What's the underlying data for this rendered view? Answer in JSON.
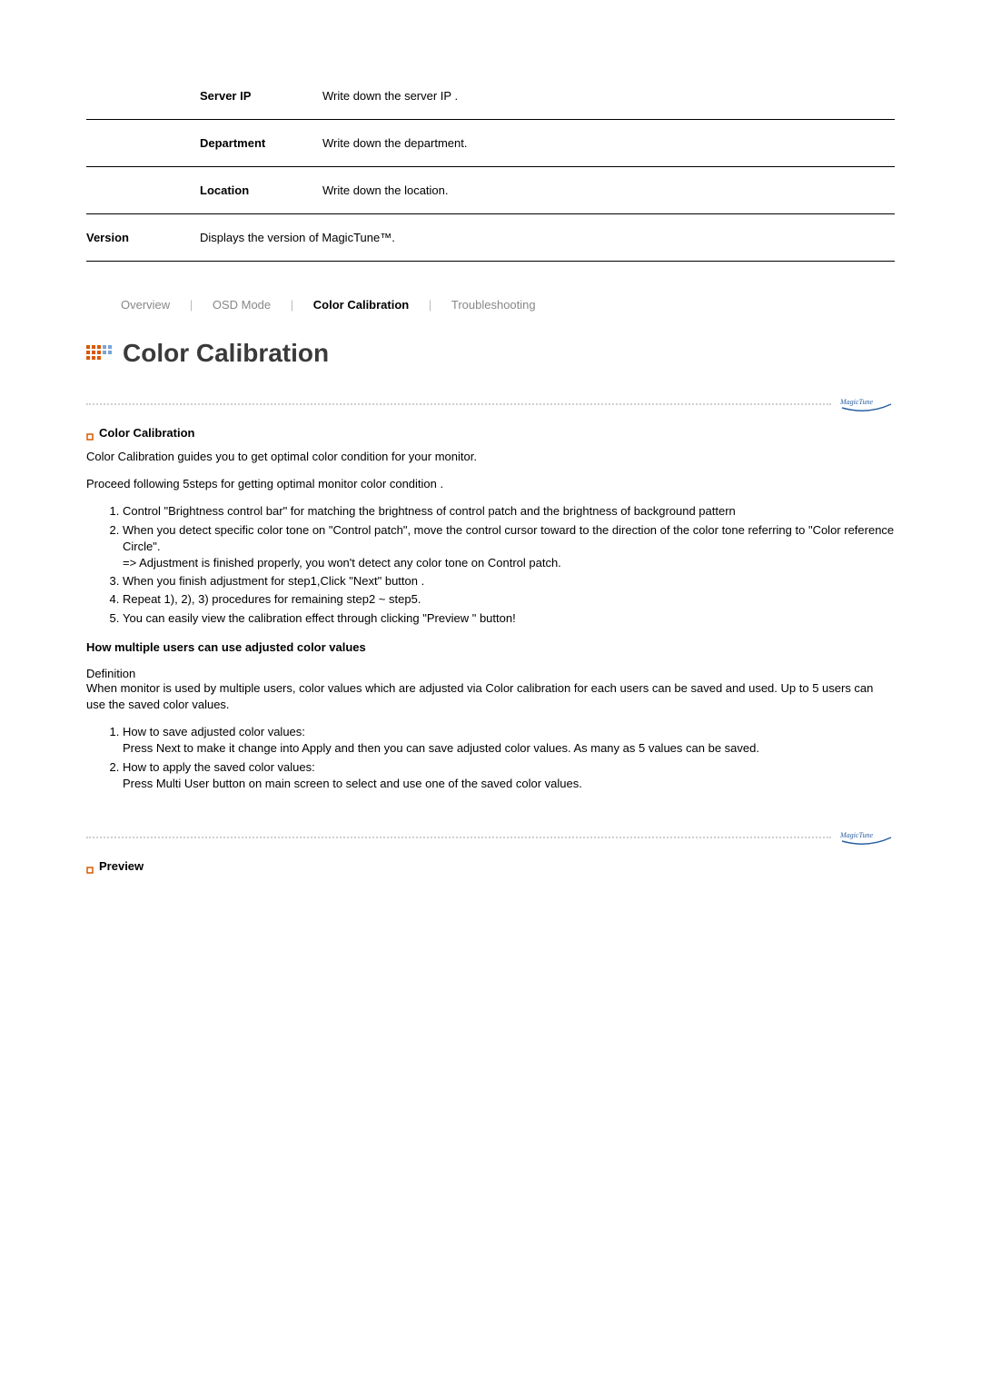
{
  "info_table": {
    "rows": [
      {
        "label": "Server IP",
        "desc": "Write down the server IP ."
      },
      {
        "label": "Department",
        "desc": "Write down the department."
      },
      {
        "label": "Location",
        "desc": "Write down the location."
      }
    ],
    "version_label": "Version",
    "version_desc": "Displays the version of MagicTune™."
  },
  "tabs": {
    "overview": "Overview",
    "osd_mode": "OSD Mode",
    "color_calibration": "Color Calibration",
    "troubleshooting": "Troubleshooting"
  },
  "section_title": "Color Calibration",
  "sub1_title": "Color Calibration",
  "sub1_intro": "Color Calibration guides you to get optimal color condition for your monitor.",
  "sub1_proceed": "Proceed following 5steps for getting optimal monitor color condition .",
  "steps": [
    "Control \"Brightness control bar\" for matching the brightness of control patch and the brightness of background pattern",
    "When you detect specific color tone on \"Control patch\", move the control cursor toward to the direction of the color tone referring to \"Color reference Circle\".\n=> Adjustment is finished properly, you won't detect any color tone on Control patch.",
    "When you finish adjustment for step1,Click \"Next\" button .",
    "Repeat 1), 2), 3) procedures for remaining step2 ~ step5.",
    "You can easily view the calibration effect through clicking \"Preview \" button!"
  ],
  "multi_title": "How multiple users can use adjusted color values",
  "multi_def_label": "Definition",
  "multi_def_text": "When monitor is used by multiple users, color values which are adjusted via Color calibration for each users can be saved and used. Up to 5 users can use the saved color values.",
  "multi_steps": [
    "How to save adjusted color values:\nPress Next to make it change into Apply and then you can save adjusted color values. As many as 5 values can be saved.",
    "How to apply the saved color values:\nPress Multi User button on main screen to select and use one of the saved color values."
  ],
  "sub2_title": "Preview"
}
